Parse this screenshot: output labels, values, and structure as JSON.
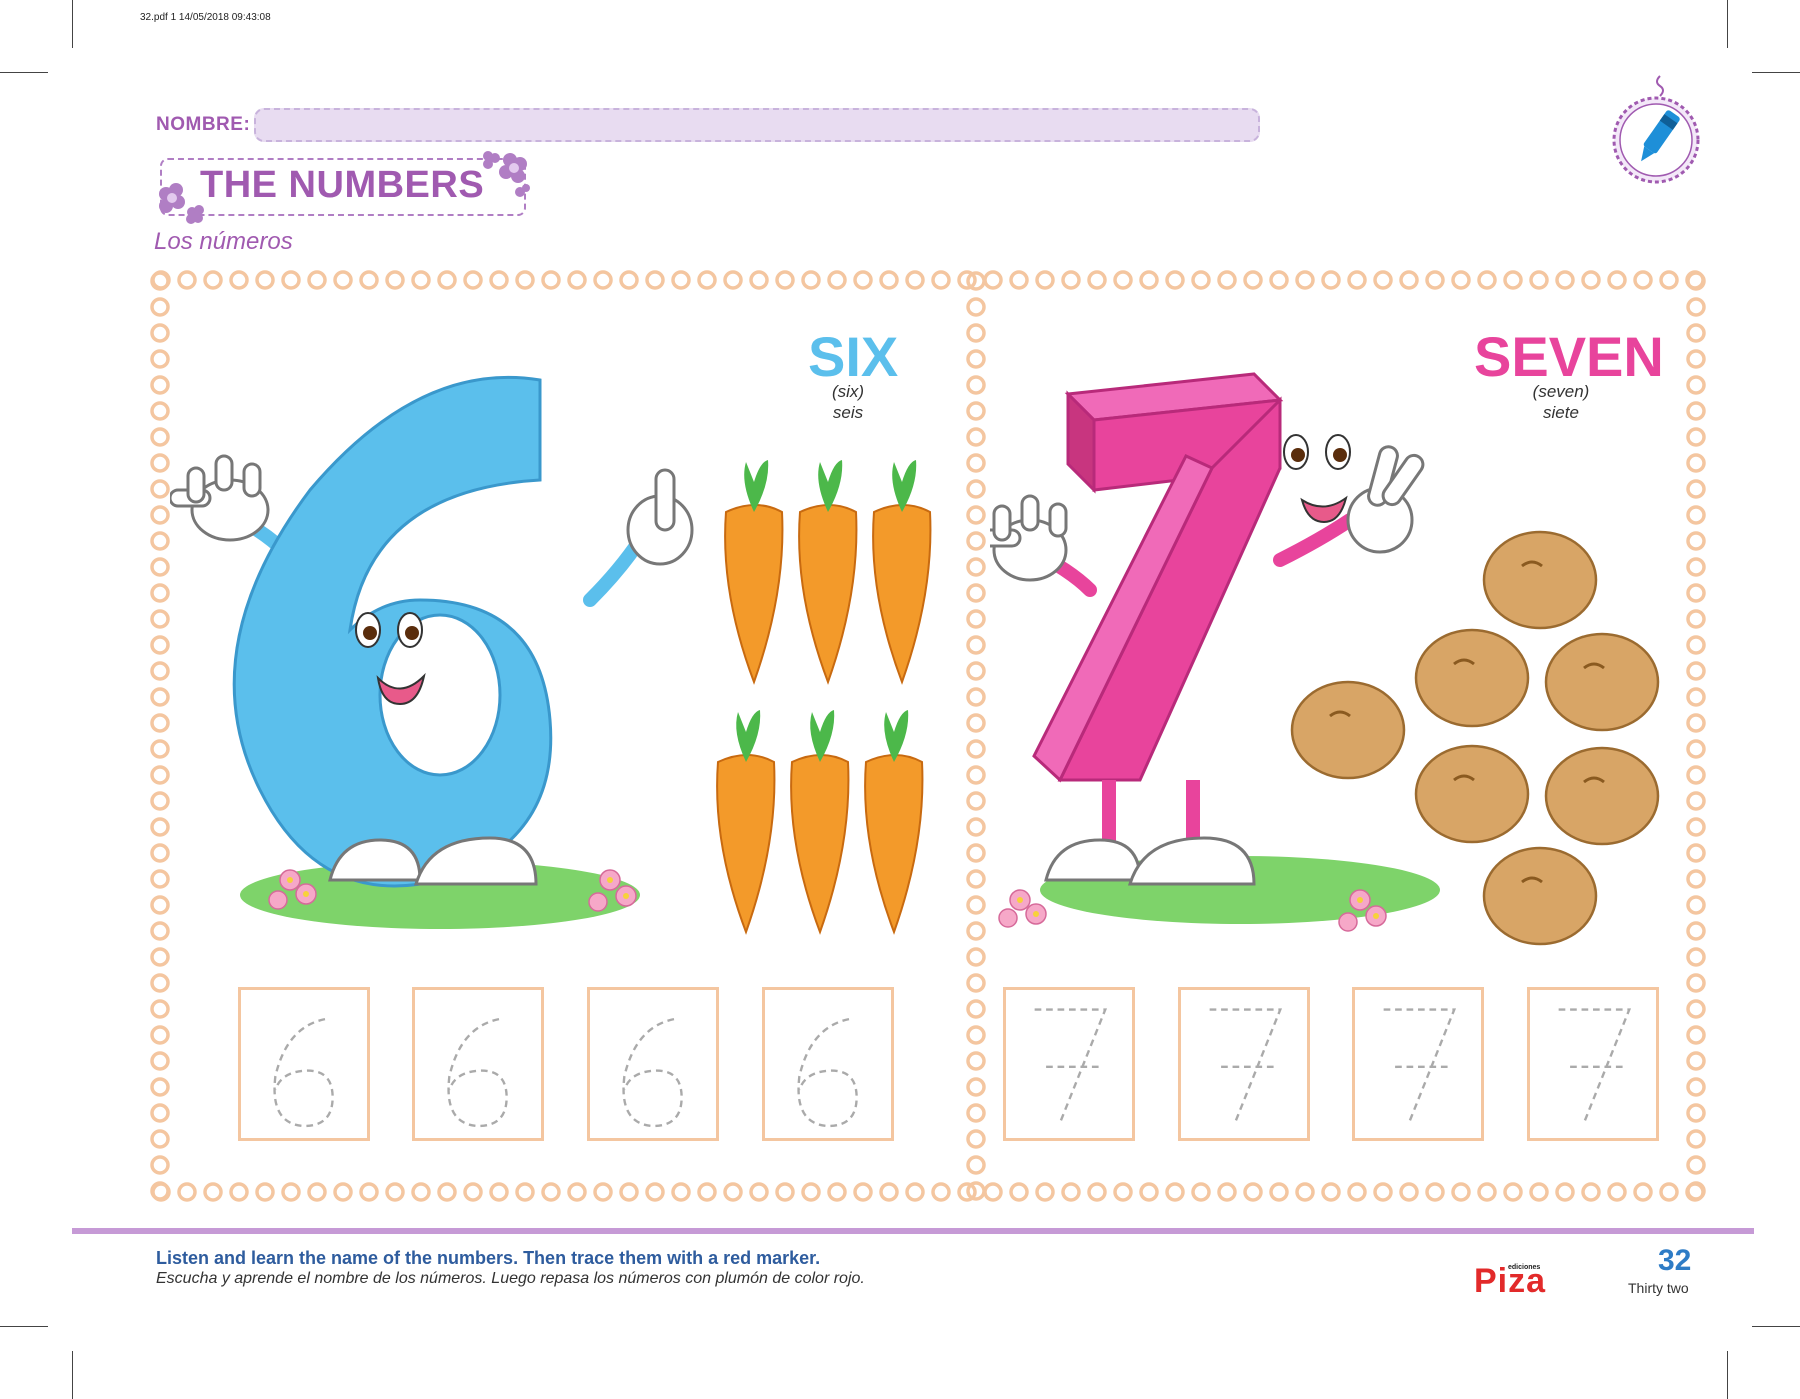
{
  "print_info": "32.pdf   1   14/05/2018   09:43:08",
  "header": {
    "name_label": "NOMBRE:",
    "title": "THE NUMBERS",
    "subtitle": "Los números"
  },
  "panels": [
    {
      "word": "SIX",
      "pronunciation": "(six)",
      "spanish": "seis",
      "digit": "6",
      "color": "#5bbfec",
      "item_icon": "carrot-icon",
      "item_count": 6,
      "trace_count": 4
    },
    {
      "word": "SEVEN",
      "pronunciation": "(seven)",
      "spanish": "siete",
      "digit": "7",
      "color": "#e8449c",
      "item_icon": "potato-icon",
      "item_count": 7,
      "trace_count": 4
    }
  ],
  "footer": {
    "instruction_en": "Listen and learn the name of the numbers. Then trace them with a red marker.",
    "instruction_es": "Escucha y aprende el nombre de los números. Luego repasa los números con plumón de color rojo.",
    "page_number": "32",
    "page_words": "Thirty two",
    "publisher_small": "ediciones",
    "publisher": "Piza"
  },
  "colors": {
    "accent_purple": "#a05ab0",
    "border_peach": "#f4c6a0",
    "six_blue": "#5bbfec",
    "seven_pink": "#e8449c",
    "page_number_blue": "#2e7cc6",
    "publisher_red": "#e22a2a"
  }
}
